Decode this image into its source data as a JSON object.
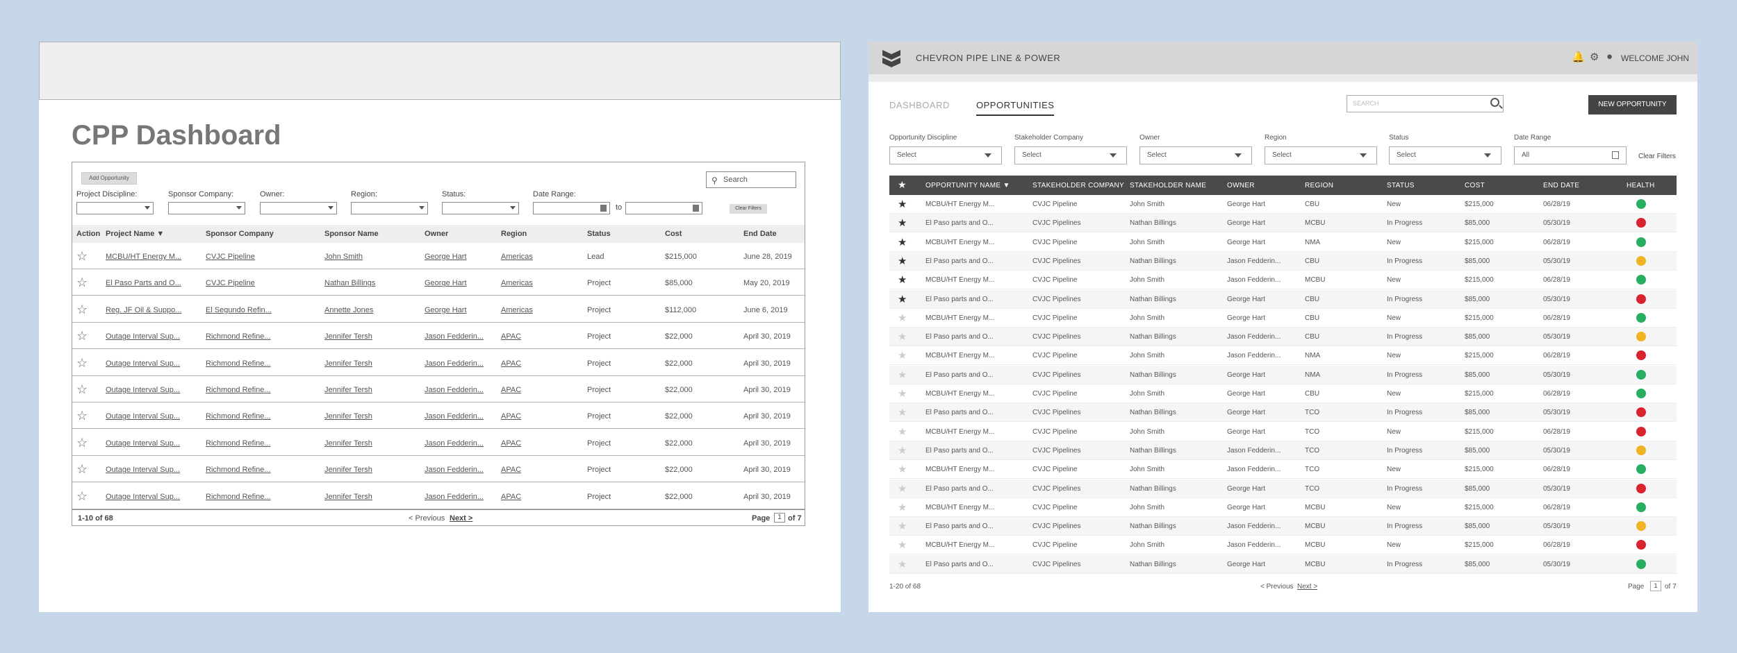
{
  "left": {
    "title": "CPP Dashboard",
    "add_button": "Add Opportunity",
    "search_placeholder": "Search",
    "filters": [
      "Project Discipline:",
      "Sponsor Company:",
      "Owner:",
      "Region:",
      "Status:",
      "Date Range:"
    ],
    "to_label": "to",
    "clear_button": "Clear Filters",
    "columns": [
      "Action",
      "Project Name",
      "Sponsor Company",
      "Sponsor Name",
      "Owner",
      "Region",
      "Status",
      "Cost",
      "End Date"
    ],
    "rows": [
      [
        "MCBU/HT Energy M...",
        "CVJC Pipeline",
        "John Smith",
        "George Hart",
        "Americas",
        "Lead",
        "$215,000",
        "June 28, 2019"
      ],
      [
        "El Paso Parts and O...",
        "CVJC Pipeline",
        "Nathan Billings",
        "George Hart",
        "Americas",
        "Project",
        "$85,000",
        "May 20, 2019"
      ],
      [
        "Reg. JF Oil & Suppo...",
        "El Segundo Refin...",
        "Annette Jones",
        "George Hart",
        "Americas",
        "Project",
        "$112,000",
        "June 6, 2019"
      ],
      [
        "Outage Interval Sup...",
        "Richmond Refine...",
        "Jennifer Tersh",
        "Jason Fedderin...",
        "APAC",
        "Project",
        "$22,000",
        "April 30, 2019"
      ],
      [
        "Outage Interval Sup...",
        "Richmond Refine...",
        "Jennifer Tersh",
        "Jason Fedderin...",
        "APAC",
        "Project",
        "$22,000",
        "April 30, 2019"
      ],
      [
        "Outage Interval Sup...",
        "Richmond Refine...",
        "Jennifer Tersh",
        "Jason Fedderin...",
        "APAC",
        "Project",
        "$22,000",
        "April 30, 2019"
      ],
      [
        "Outage Interval Sup...",
        "Richmond Refine...",
        "Jennifer Tersh",
        "Jason Fedderin...",
        "APAC",
        "Project",
        "$22,000",
        "April 30, 2019"
      ],
      [
        "Outage Interval Sup...",
        "Richmond Refine...",
        "Jennifer Tersh",
        "Jason Fedderin...",
        "APAC",
        "Project",
        "$22,000",
        "April 30, 2019"
      ],
      [
        "Outage Interval Sup...",
        "Richmond Refine...",
        "Jennifer Tersh",
        "Jason Fedderin...",
        "APAC",
        "Project",
        "$22,000",
        "April 30, 2019"
      ],
      [
        "Outage Interval Sup...",
        "Richmond Refine...",
        "Jennifer Tersh",
        "Jason Fedderin...",
        "APAC",
        "Project",
        "$22,000",
        "April 30, 2019"
      ]
    ],
    "footer": {
      "count": "1-10 of 68",
      "prev": "< Previous",
      "next": "Next >",
      "page_label": "Page",
      "page": "1",
      "of": "of 7"
    }
  },
  "right": {
    "brand": "CHEVRON PIPE LINE & POWER",
    "welcome": "WELCOME JOHN",
    "tabs": {
      "dashboard": "DASHBOARD",
      "opportunities": "OPPORTUNITIES"
    },
    "search_placeholder": "SEARCH",
    "new_button": "NEW OPPORTUNITY",
    "filters": [
      {
        "label": "Opportunity Discipline",
        "value": "Select"
      },
      {
        "label": "Stakeholder Company",
        "value": "Select"
      },
      {
        "label": "Owner",
        "value": "Select"
      },
      {
        "label": "Region",
        "value": "Select"
      },
      {
        "label": "Status",
        "value": "Select"
      },
      {
        "label": "Date Range",
        "value": "All"
      }
    ],
    "clear_filters": "Clear Filters",
    "columns": [
      "OPPORTUNITY NAME",
      "STAKEHOLDER COMPANY",
      "STAKEHOLDER NAME",
      "OWNER",
      "REGION",
      "STATUS",
      "COST",
      "END DATE",
      "HEALTH"
    ],
    "colors": {
      "green": "#27ae60",
      "red": "#d9232d",
      "amber": "#f0b323"
    },
    "rows": [
      {
        "fav": true,
        "cells": [
          "MCBU/HT Energy M...",
          "CVJC Pipeline",
          "John Smith",
          "George Hart",
          "CBU",
          "New",
          "$215,000",
          "06/28/19"
        ],
        "health": "green"
      },
      {
        "fav": true,
        "cells": [
          "El Paso parts and O...",
          "CVJC Pipelines",
          "Nathan Billings",
          "George Hart",
          "MCBU",
          "In Progress",
          "$85,000",
          "05/30/19"
        ],
        "health": "red"
      },
      {
        "fav": true,
        "cells": [
          "MCBU/HT Energy M...",
          "CVJC Pipeline",
          "John Smith",
          "George Hart",
          "NMA",
          "New",
          "$215,000",
          "06/28/19"
        ],
        "health": "green"
      },
      {
        "fav": true,
        "cells": [
          "El Paso parts and O...",
          "CVJC Pipelines",
          "Nathan Billings",
          "Jason Fedderin...",
          "CBU",
          "In Progress",
          "$85,000",
          "05/30/19"
        ],
        "health": "amber"
      },
      {
        "fav": true,
        "cells": [
          "MCBU/HT Energy M...",
          "CVJC Pipeline",
          "John Smith",
          "Jason Fedderin...",
          "MCBU",
          "New",
          "$215,000",
          "06/28/19"
        ],
        "health": "green"
      },
      {
        "fav": true,
        "cells": [
          "El Paso parts and O...",
          "CVJC Pipelines",
          "Nathan Billings",
          "George Hart",
          "CBU",
          "In Progress",
          "$85,000",
          "05/30/19"
        ],
        "health": "red"
      },
      {
        "fav": false,
        "cells": [
          "MCBU/HT Energy M...",
          "CVJC Pipeline",
          "John Smith",
          "George Hart",
          "CBU",
          "New",
          "$215,000",
          "06/28/19"
        ],
        "health": "green"
      },
      {
        "fav": false,
        "cells": [
          "El Paso parts and O...",
          "CVJC Pipelines",
          "Nathan Billings",
          "Jason Fedderin...",
          "CBU",
          "In Progress",
          "$85,000",
          "05/30/19"
        ],
        "health": "amber"
      },
      {
        "fav": false,
        "cells": [
          "MCBU/HT Energy M...",
          "CVJC Pipeline",
          "John Smith",
          "Jason Fedderin...",
          "NMA",
          "New",
          "$215,000",
          "06/28/19"
        ],
        "health": "red"
      },
      {
        "fav": false,
        "cells": [
          "El Paso parts and O...",
          "CVJC Pipelines",
          "Nathan Billings",
          "George Hart",
          "NMA",
          "In Progress",
          "$85,000",
          "05/30/19"
        ],
        "health": "green"
      },
      {
        "fav": false,
        "cells": [
          "MCBU/HT Energy M...",
          "CVJC Pipeline",
          "John Smith",
          "George Hart",
          "CBU",
          "New",
          "$215,000",
          "06/28/19"
        ],
        "health": "green"
      },
      {
        "fav": false,
        "cells": [
          "El Paso parts and O...",
          "CVJC Pipelines",
          "Nathan Billings",
          "George Hart",
          "TCO",
          "In Progress",
          "$85,000",
          "05/30/19"
        ],
        "health": "red"
      },
      {
        "fav": false,
        "cells": [
          "MCBU/HT Energy M...",
          "CVJC Pipeline",
          "John Smith",
          "George Hart",
          "TCO",
          "New",
          "$215,000",
          "06/28/19"
        ],
        "health": "red"
      },
      {
        "fav": false,
        "cells": [
          "El Paso parts and O...",
          "CVJC Pipelines",
          "Nathan Billings",
          "Jason Fedderin...",
          "TCO",
          "In Progress",
          "$85,000",
          "05/30/19"
        ],
        "health": "amber"
      },
      {
        "fav": false,
        "cells": [
          "MCBU/HT Energy M...",
          "CVJC Pipeline",
          "John Smith",
          "Jason Fedderin...",
          "TCO",
          "New",
          "$215,000",
          "06/28/19"
        ],
        "health": "green"
      },
      {
        "fav": false,
        "cells": [
          "El Paso parts and O...",
          "CVJC Pipelines",
          "Nathan Billings",
          "George Hart",
          "TCO",
          "In Progress",
          "$85,000",
          "05/30/19"
        ],
        "health": "red"
      },
      {
        "fav": false,
        "cells": [
          "MCBU/HT Energy M...",
          "CVJC Pipeline",
          "John Smith",
          "George Hart",
          "MCBU",
          "New",
          "$215,000",
          "06/28/19"
        ],
        "health": "green"
      },
      {
        "fav": false,
        "cells": [
          "El Paso parts and O...",
          "CVJC Pipelines",
          "Nathan Billings",
          "Jason Fedderin...",
          "MCBU",
          "In Progress",
          "$85,000",
          "05/30/19"
        ],
        "health": "amber"
      },
      {
        "fav": false,
        "cells": [
          "MCBU/HT Energy M...",
          "CVJC Pipeline",
          "John Smith",
          "Jason Fedderin...",
          "MCBU",
          "New",
          "$215,000",
          "06/28/19"
        ],
        "health": "red"
      },
      {
        "fav": false,
        "cells": [
          "El Paso parts and O...",
          "CVJC Pipelines",
          "Nathan Billings",
          "George Hart",
          "MCBU",
          "In Progress",
          "$85,000",
          "05/30/19"
        ],
        "health": "green"
      }
    ],
    "footer": {
      "count": "1-20 of 68",
      "prev": "< Previous",
      "next": "Next >",
      "page_label": "Page",
      "page": "1",
      "of": "of 7"
    }
  }
}
